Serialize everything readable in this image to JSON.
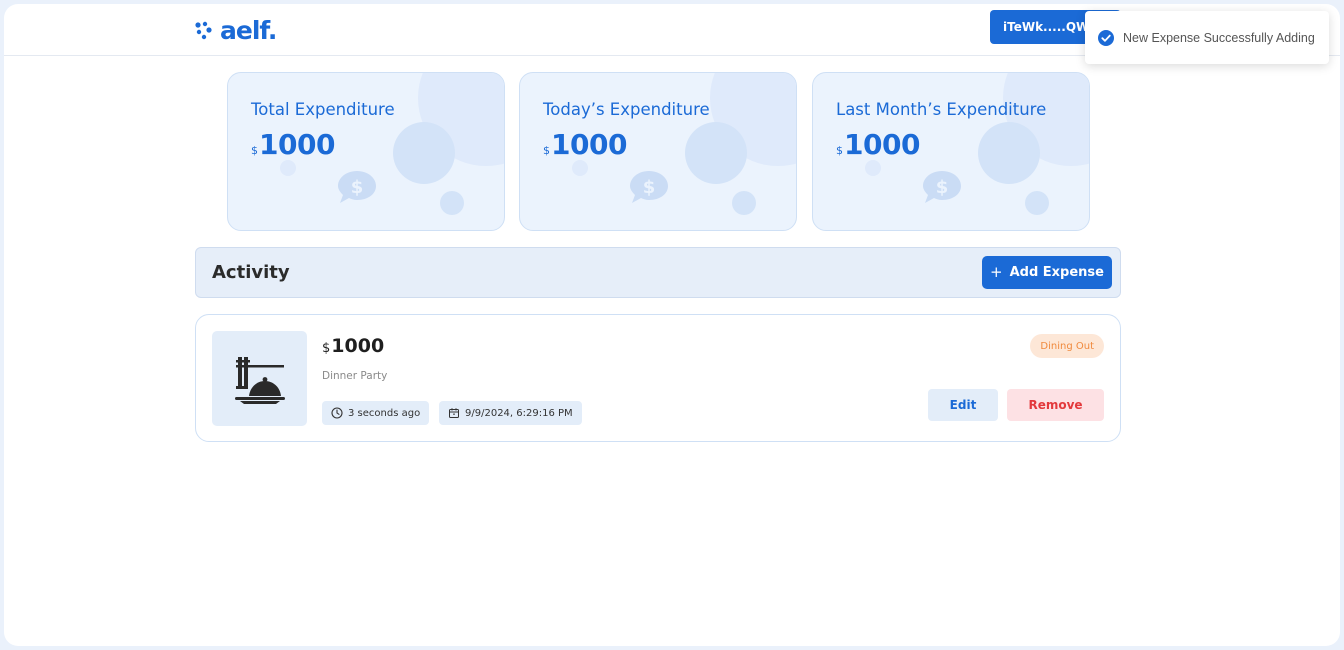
{
  "header": {
    "logo_text": "aelf.",
    "wallet_label": "iTeWk.....QW3"
  },
  "toast": {
    "message": "New Expense Successfully Adding",
    "icon": "check-circle-icon"
  },
  "summary_cards": [
    {
      "title": "Total Expenditure",
      "currency": "$",
      "value": "1000",
      "icon": "dollar-chat-icon"
    },
    {
      "title": "Today’s Expenditure",
      "currency": "$",
      "value": "1000",
      "icon": "dollar-chat-icon"
    },
    {
      "title": "Last Month’s Expenditure",
      "currency": "$",
      "value": "1000",
      "icon": "dollar-chat-icon"
    }
  ],
  "activity": {
    "title": "Activity",
    "add_button_icon": "plus-icon",
    "add_button_label": "Add Expense"
  },
  "expenses": [
    {
      "icon": "dining-cloche-icon",
      "currency": "$",
      "amount": "1000",
      "description": "Dinner Party",
      "relative_time": "3 seconds ago",
      "datetime": "9/9/2024, 6:29:16 PM",
      "category": "Dining Out",
      "edit_label": "Edit",
      "remove_label": "Remove"
    }
  ],
  "colors": {
    "accent": "#1b6ad6",
    "card_bg": "#ebf3fd",
    "category_bg": "#fde7d7",
    "category_text": "#f08a3e",
    "remove_bg": "#fde1e4",
    "remove_text": "#e3393c"
  }
}
